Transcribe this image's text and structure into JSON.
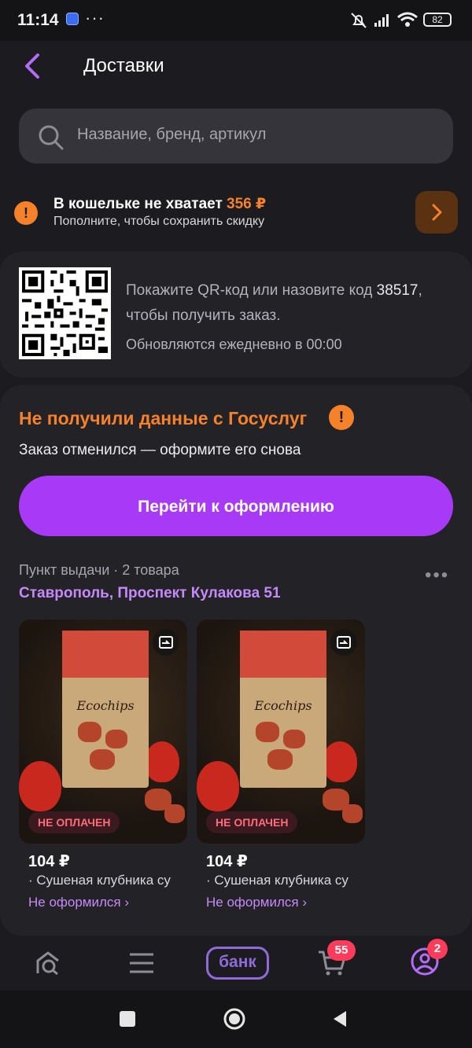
{
  "status_bar": {
    "time": "11:14",
    "dots": "···",
    "battery": "82"
  },
  "header": {
    "title": "Доставки"
  },
  "search": {
    "placeholder": "Название, бренд, артикул"
  },
  "wallet": {
    "text": "В кошельке не хватает",
    "amount": "356 ₽",
    "subtitle": "Пополните, чтобы сохранить скидку"
  },
  "qr_card": {
    "text_before_code": "Покажите QR-код или назовите код",
    "code": "38517",
    "text_after_code": ", чтобы получить заказ.",
    "update_note": "Обновляются ежедневно в 00:00"
  },
  "order": {
    "warning_title": "Не получили данные с Госуслуг",
    "warning_subtitle": "Заказ отменился — оформите его снова",
    "cta_label": "Перейти к оформлению",
    "pickup_info": "Пункт выдачи · 2 товара",
    "address": "Ставрополь, Проспект Кулакова 51",
    "products": [
      {
        "badge": "НЕ ОПЛАЧЕН",
        "price": "104 ₽",
        "name": "· Сушеная клубника су",
        "status": "Не оформился ›",
        "pack_brand": "Ecochips"
      },
      {
        "badge": "НЕ ОПЛАЧЕН",
        "price": "104 ₽",
        "name": "· Сушеная клубника су",
        "status": "Не оформился ›",
        "pack_brand": "Ecochips"
      }
    ]
  },
  "tab_bar": {
    "bank_label": "банк",
    "cart_count": "55",
    "profile_count": "2"
  },
  "colors": {
    "accent": "#a83af7",
    "warning": "#f5822a",
    "link": "#c58af9",
    "error": "#ff6b7a"
  }
}
